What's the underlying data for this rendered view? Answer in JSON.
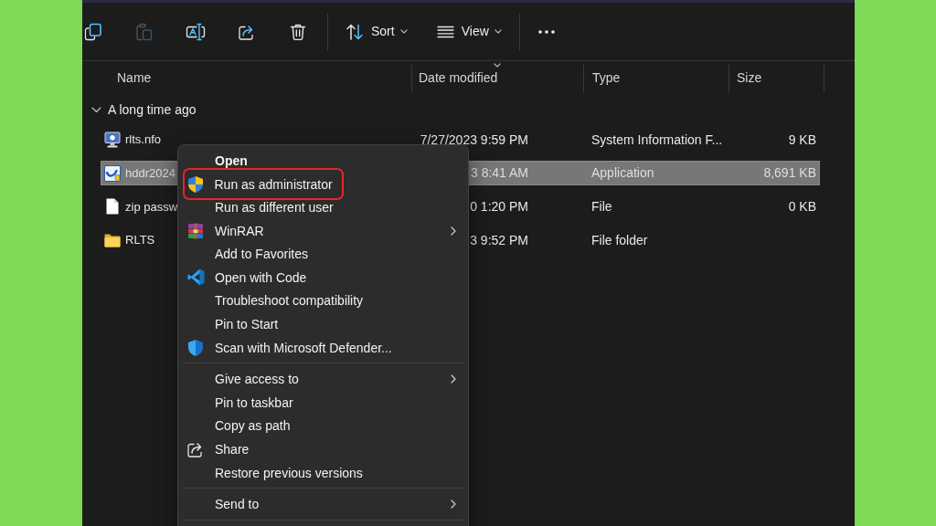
{
  "toolbar": {
    "icon_buttons": [
      {
        "disabled": false
      },
      {
        "disabled": true
      },
      {
        "disabled": false
      },
      {
        "disabled": false
      },
      {
        "disabled": false
      }
    ],
    "menu_buttons": [
      {
        "label": "Sort"
      },
      {
        "label": "View"
      }
    ]
  },
  "columns": [
    {
      "label": "Name",
      "sorted": false
    },
    {
      "label": "Date modified",
      "sorted": true
    },
    {
      "label": "Type",
      "sorted": false
    },
    {
      "label": "Size",
      "sorted": false
    }
  ],
  "group": {
    "label": "A long time ago",
    "expanded": true
  },
  "rows": [
    {
      "kind": "info",
      "name": "rlts.nfo",
      "date": "7/27/2023 9:59 PM",
      "type": "System Information F...",
      "size": "9 KB",
      "selected": false
    },
    {
      "kind": "application",
      "name": "hddr2024",
      "date": "3 8:41 AM",
      "type": "Application",
      "size": "8,691 KB",
      "selected": true
    },
    {
      "kind": "file",
      "name": "zip passw",
      "date": "0 1:20 PM",
      "type": "File",
      "size": "0 KB",
      "selected": false
    },
    {
      "kind": "folder",
      "name": "RLTS",
      "date": "3 9:52 PM",
      "type": "File folder",
      "selected": false
    }
  ],
  "menu": {
    "sections": [
      [
        {
          "label": "Open",
          "is_default": true,
          "has_submenu": false,
          "highlighted": false
        },
        {
          "label": "Run as administrator",
          "is_default": false,
          "has_submenu": false,
          "highlighted": true
        },
        {
          "label": "Run as different user",
          "is_default": false,
          "has_submenu": false,
          "highlighted": false
        },
        {
          "label": "WinRAR",
          "is_default": false,
          "has_submenu": true,
          "highlighted": false
        },
        {
          "label": "Add to Favorites",
          "is_default": false,
          "has_submenu": false,
          "highlighted": false
        },
        {
          "label": "Open with Code",
          "is_default": false,
          "has_submenu": false,
          "highlighted": false
        },
        {
          "label": "Troubleshoot compatibility",
          "is_default": false,
          "has_submenu": false,
          "highlighted": false
        },
        {
          "label": "Pin to Start",
          "is_default": false,
          "has_submenu": false,
          "highlighted": false
        },
        {
          "label": "Scan with Microsoft Defender...",
          "is_default": false,
          "has_submenu": false,
          "highlighted": false
        }
      ],
      [
        {
          "label": "Give access to",
          "is_default": false,
          "has_submenu": true,
          "highlighted": false
        },
        {
          "label": "Pin to taskbar",
          "is_default": false,
          "has_submenu": false,
          "highlighted": false
        },
        {
          "label": "Copy as path",
          "is_default": false,
          "has_submenu": false,
          "highlighted": false
        },
        {
          "label": "Share",
          "is_default": false,
          "has_submenu": false,
          "highlighted": false
        },
        {
          "label": "Restore previous versions",
          "is_default": false,
          "has_submenu": false,
          "highlighted": false
        }
      ],
      [
        {
          "label": "Send to",
          "is_default": false,
          "has_submenu": true,
          "highlighted": false
        }
      ]
    ]
  }
}
